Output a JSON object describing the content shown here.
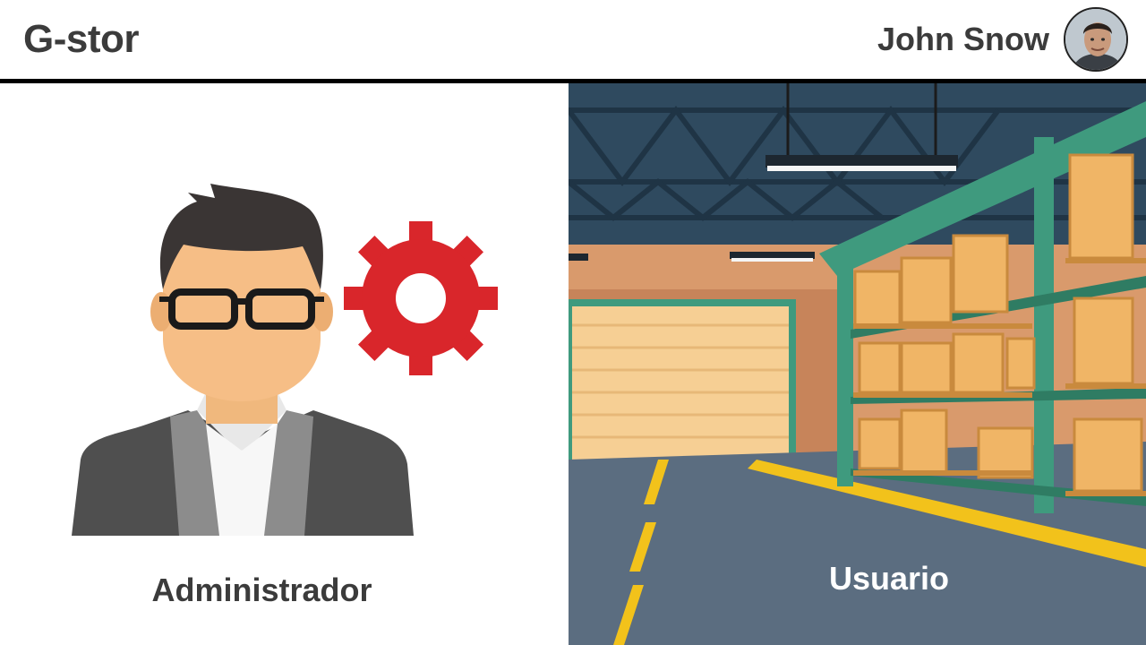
{
  "header": {
    "app_title": "G-stor",
    "user_name": "John Snow"
  },
  "roles": {
    "admin_label": "Administrador",
    "user_label": "Usuario"
  },
  "colors": {
    "gear": "#d9262b",
    "shelf": "#3f9a7e",
    "floor": "#5b6d80"
  }
}
